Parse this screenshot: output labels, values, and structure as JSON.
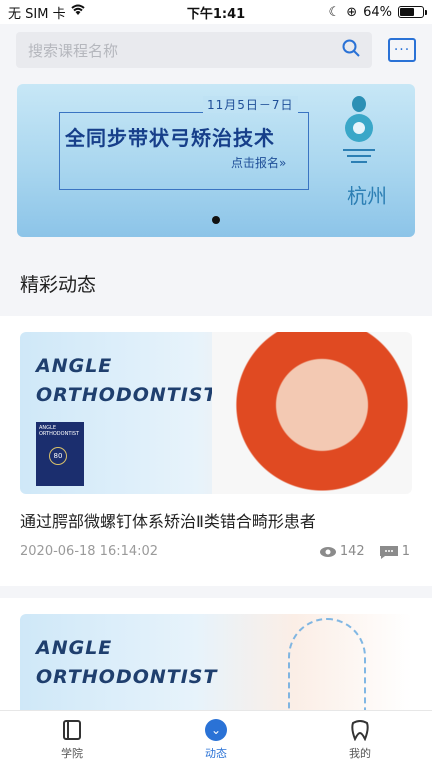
{
  "status_bar": {
    "carrier": "无 SIM 卡",
    "time": "下午1:41",
    "battery": "64%",
    "battery_level": 0.64
  },
  "search": {
    "placeholder": "搜索课程名称"
  },
  "banner": {
    "date": "11月5日－7日",
    "title": "全同步带状弓矫治技术",
    "cta": "点击报名»",
    "city": "杭州"
  },
  "section": {
    "title": "精彩动态"
  },
  "posts": [
    {
      "journal": [
        "ANGLE",
        "ORTHODONTIST"
      ],
      "cover_title": "ANGLE ORTHODONTIST",
      "cover_badge": "80",
      "title": "通过腭部微螺钉体系矫治Ⅱ类错合畸形患者",
      "date": "2020-06-18 16:14:02",
      "views": "142",
      "comments": "1"
    },
    {
      "journal": [
        "ANGLE",
        "ORTHODONTIST"
      ]
    }
  ],
  "tabs": [
    {
      "label": "学院",
      "icon": "book-icon"
    },
    {
      "label": "动态",
      "icon": "chevron-down-circle-icon"
    },
    {
      "label": "我的",
      "icon": "tooth-icon"
    }
  ],
  "colors": {
    "accent": "#2a72d6",
    "banner_title": "#173f8a"
  }
}
